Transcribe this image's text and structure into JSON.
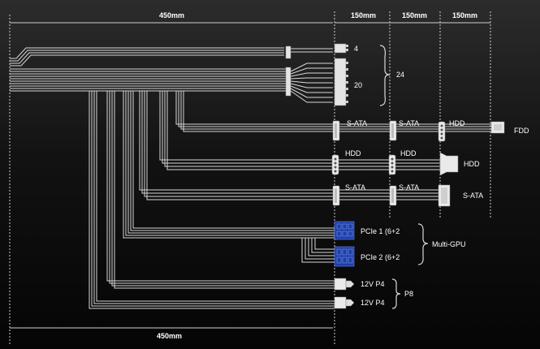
{
  "dimensions": {
    "top_main": "450mm",
    "seg1": "150mm",
    "seg2": "150mm",
    "seg3": "150mm",
    "bottom_main": "450mm"
  },
  "atx": {
    "pin4": "4",
    "pin20": "20",
    "total": "24"
  },
  "row1": {
    "c1": "S-ATA",
    "c2": "S-ATA",
    "c3": "HDD",
    "end": "FDD"
  },
  "row2": {
    "c1": "HDD",
    "c2": "HDD",
    "end": "HDD"
  },
  "row3": {
    "c1": "S-ATA",
    "c2": "S-ATA",
    "end": "S-ATA"
  },
  "pcie": {
    "p1": "PCIe 1 (6+2",
    "p2": "PCIe 2 (6+2",
    "group": "Multi-GPU"
  },
  "p4": {
    "a": "12V P4",
    "b": "12V P4",
    "group": "P8"
  },
  "colors": {
    "wire": "#d8d8d8",
    "pcie_connector": "#1d3fa6",
    "text": "#ffffff",
    "dashed_guide": "#cfcfcf"
  }
}
